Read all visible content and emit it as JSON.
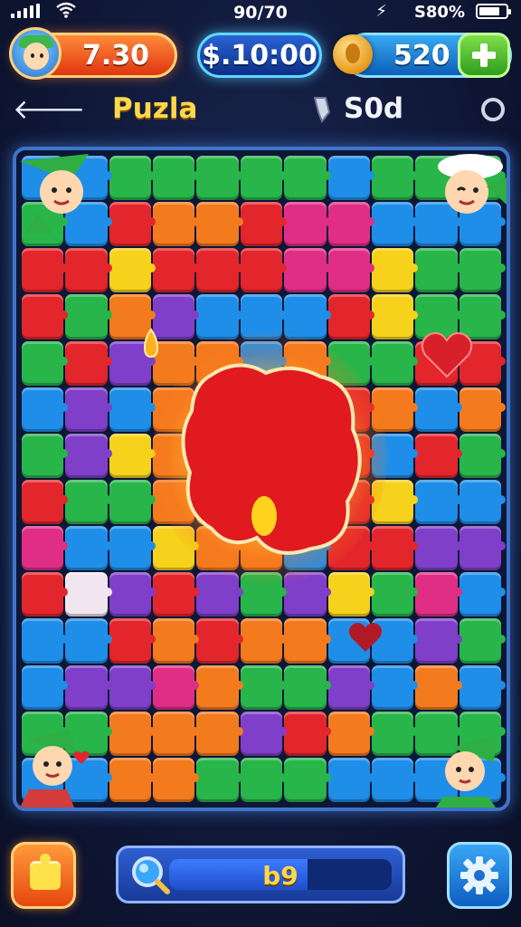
{
  "status_bar": {
    "time": "90/70",
    "battery_text": "S80%",
    "battery_level": 0.8
  },
  "hud": {
    "level_value": "7.30",
    "money_value": "$.10:00",
    "gems_value": "520"
  },
  "header": {
    "title": "Puzla",
    "score": "S0d"
  },
  "bottom_bar": {
    "progress_value": "b9"
  },
  "board": {
    "rows": [
      [
        "blue",
        "blue",
        "green",
        "green",
        "green",
        "green",
        "green",
        "blue",
        "green",
        "green",
        "green"
      ],
      [
        "green",
        "blue",
        "red",
        "orange",
        "orange",
        "red",
        "pink",
        "pink",
        "blue",
        "blue",
        "blue"
      ],
      [
        "red",
        "red",
        "yellow",
        "red",
        "red",
        "red",
        "pink",
        "pink",
        "yellow",
        "green",
        "green"
      ],
      [
        "red",
        "green",
        "orange",
        "purple",
        "blue",
        "blue",
        "blue",
        "red",
        "yellow",
        "green",
        "green"
      ],
      [
        "green",
        "red",
        "purple",
        "orange",
        "orange",
        "blue",
        "orange",
        "green",
        "green",
        "red",
        "red"
      ],
      [
        "blue",
        "purple",
        "blue",
        "orange",
        "orange",
        "orange",
        "orange",
        "red",
        "orange",
        "blue",
        "orange"
      ],
      [
        "green",
        "purple",
        "yellow",
        "orange",
        "orange",
        "orange",
        "orange",
        "red",
        "blue",
        "red",
        "green"
      ],
      [
        "red",
        "green",
        "green",
        "orange",
        "orange",
        "orange",
        "blue",
        "red",
        "yellow",
        "blue",
        "blue"
      ],
      [
        "pink",
        "blue",
        "blue",
        "yellow",
        "orange",
        "orange",
        "blue",
        "red",
        "red",
        "purple",
        "purple"
      ],
      [
        "red",
        "white",
        "purple",
        "red",
        "purple",
        "green",
        "purple",
        "yellow",
        "green",
        "pink",
        "blue"
      ],
      [
        "blue",
        "blue",
        "red",
        "orange",
        "red",
        "orange",
        "orange",
        "blue",
        "blue",
        "purple",
        "green"
      ],
      [
        "blue",
        "purple",
        "purple",
        "pink",
        "orange",
        "green",
        "green",
        "purple",
        "blue",
        "orange",
        "blue"
      ],
      [
        "green",
        "green",
        "orange",
        "orange",
        "orange",
        "purple",
        "red",
        "orange",
        "green",
        "green",
        "green"
      ],
      [
        "blue",
        "blue",
        "orange",
        "orange",
        "green",
        "green",
        "green",
        "blue",
        "blue",
        "blue",
        "blue"
      ]
    ]
  },
  "colors": {
    "red": "#e3262b",
    "orange": "#f47a1e",
    "yellow": "#f6d21c",
    "green": "#28b54a",
    "blue": "#1f8ee8",
    "purple": "#7f3fc9",
    "pink": "#e02e86",
    "white": "#f1e6ef",
    "accent_gold": "#ffd84a",
    "frame_blue": "#3e74c9"
  },
  "icons": {
    "back": "arrow-left-icon",
    "settings": "gear-icon",
    "add": "plus-icon",
    "hint": "puzzle-piece-icon",
    "search": "magnifier-icon"
  }
}
